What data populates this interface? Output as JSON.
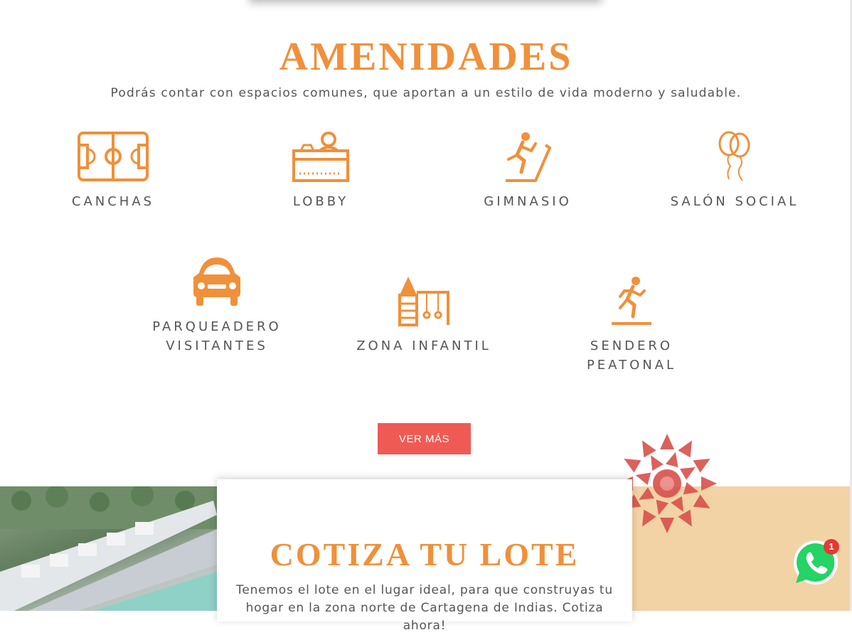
{
  "amenities_section": {
    "title": "AMENIDADES",
    "subtitle": "Podrás contar con espacios comunes, que aportan a un estilo de vida moderno y saludable.",
    "items": [
      {
        "label": "CANCHAS",
        "icon": "soccer-field-icon"
      },
      {
        "label": "LOBBY",
        "icon": "reception-desk-icon"
      },
      {
        "label": "GIMNASIO",
        "icon": "treadmill-runner-icon"
      },
      {
        "label": "SALÓN SOCIAL",
        "icon": "balloons-icon"
      },
      {
        "label": "PARQUEADERO VISITANTES",
        "icon": "car-icon"
      },
      {
        "label": "ZONA INFANTIL",
        "icon": "playground-icon"
      },
      {
        "label": "SENDERO PEATONAL",
        "icon": "walking-path-icon"
      }
    ],
    "button_label": "VER MÁS"
  },
  "quote_section": {
    "title": "COTIZA TU LOTE",
    "text": "Tenemos el lote en el lugar ideal, para que construyas tu hogar en la zona norte de Cartagena de Indias. Cotiza ahora!"
  },
  "whatsapp": {
    "badge_count": "1",
    "icon": "whatsapp-icon"
  },
  "colors": {
    "accent": "#f0903a",
    "button": "#f05a55",
    "tan": "#f2d3a6",
    "flower": "#d9544f"
  }
}
